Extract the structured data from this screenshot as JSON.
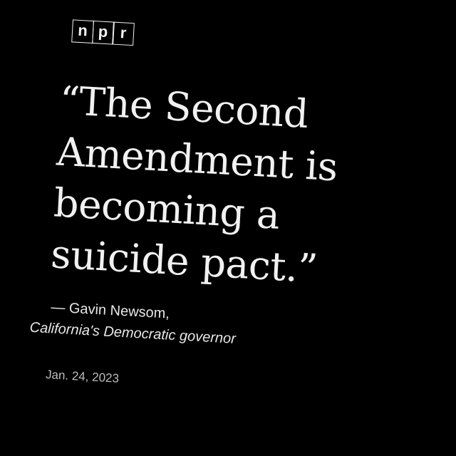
{
  "logo": {
    "letters": [
      "n",
      "p",
      "r"
    ]
  },
  "quote": {
    "text": "“The Second Amendment is becoming a suicide pact.”"
  },
  "attribution": {
    "name": "— Gavin Newsom,",
    "role": "California's Democratic governor"
  },
  "date": "Jan. 24, 2023",
  "colors": {
    "background": "#000000",
    "text": "#f1f1f1",
    "date_text": "#bdbdbd"
  }
}
